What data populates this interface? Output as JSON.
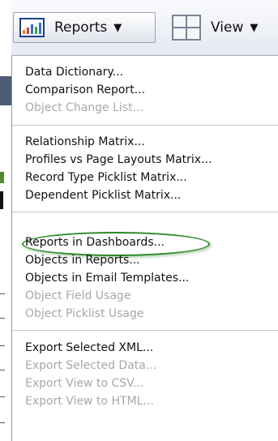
{
  "toolbar": {
    "reports_label": "Reports",
    "view_label": "View",
    "reports_icon": "bar-chart-icon",
    "view_icon": "grid-layout-icon"
  },
  "menu": {
    "groups": [
      [
        {
          "label": "Data Dictionary...",
          "enabled": true
        },
        {
          "label": "Comparison Report...",
          "enabled": true
        },
        {
          "label": "Object Change List...",
          "enabled": false
        }
      ],
      [
        {
          "label": "Relationship Matrix...",
          "enabled": true
        },
        {
          "label": "Profiles vs Page Layouts Matrix...",
          "enabled": true
        },
        {
          "label": "Record Type Picklist Matrix...",
          "enabled": true
        },
        {
          "label": "Dependent Picklist Matrix...",
          "enabled": true
        }
      ],
      [
        {
          "label": "Reports in Dashboards...",
          "enabled": true,
          "highlighted": true
        },
        {
          "label": "Objects in Reports...",
          "enabled": true
        },
        {
          "label": "Objects in Email Templates...",
          "enabled": true
        },
        {
          "label": "Object Field Usage",
          "enabled": false
        },
        {
          "label": "Object Picklist Usage",
          "enabled": false
        }
      ],
      [
        {
          "label": "Export Selected XML...",
          "enabled": true
        },
        {
          "label": "Export Selected Data...",
          "enabled": false
        },
        {
          "label": "Export View to CSV...",
          "enabled": false
        },
        {
          "label": "Export View to HTML...",
          "enabled": false
        }
      ]
    ]
  },
  "colors": {
    "highlight_oval": "#2f8a2c",
    "disabled_text": "#a8a8a8",
    "enabled_text": "#111111"
  }
}
